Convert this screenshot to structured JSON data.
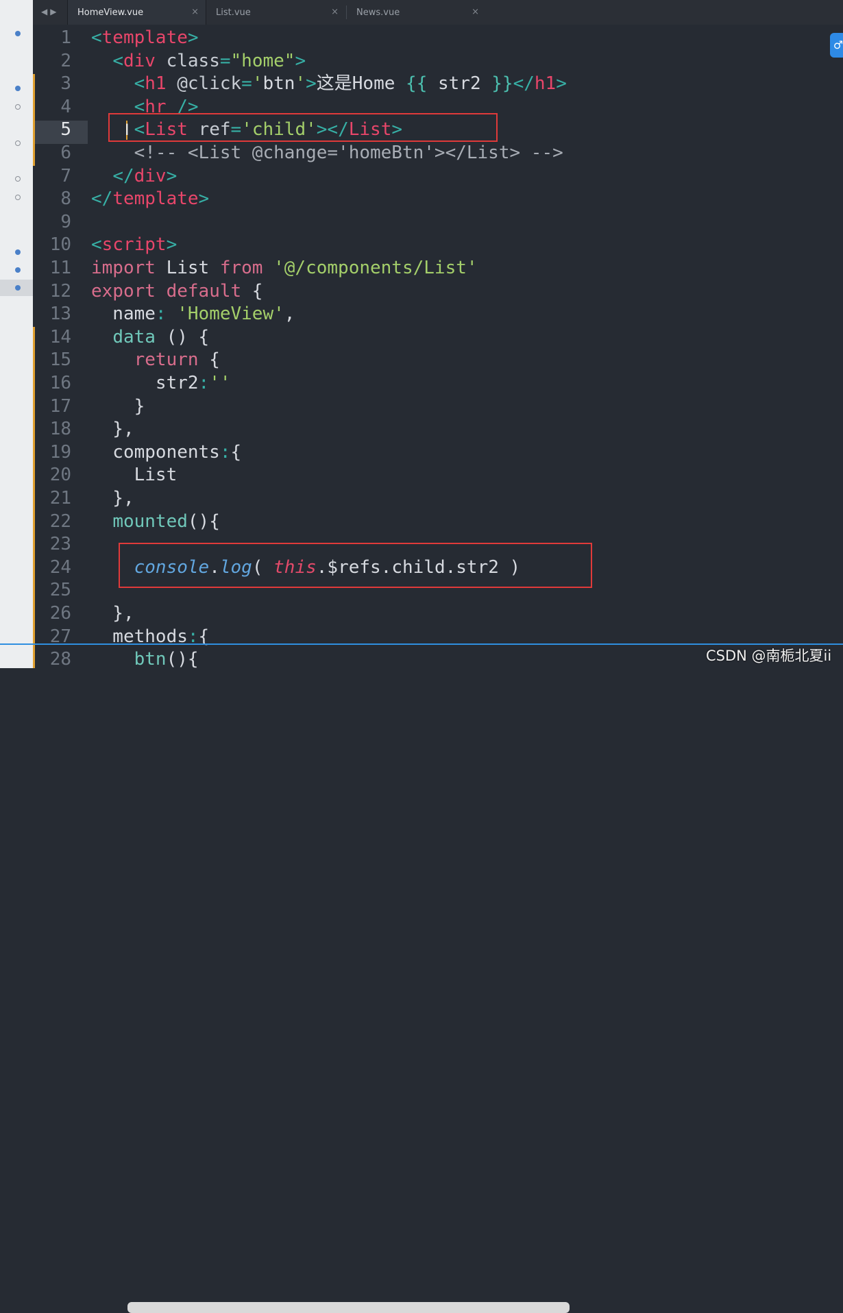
{
  "tabs": [
    {
      "label": "HomeView.vue",
      "active": true
    },
    {
      "label": "List.vue",
      "active": false
    },
    {
      "label": "News.vue",
      "active": false
    }
  ],
  "nav": {
    "back": "◀",
    "forward": "▶"
  },
  "close_glyph": "×",
  "current_line": 5,
  "watermark": "CSDN @南栀北夏ii",
  "right_widget_glyph": "♂",
  "icons": {
    "nav_back": "left-triangle-arrow",
    "nav_forward": "right-triangle-arrow",
    "close": "x-mark",
    "right_widget": "link-icon",
    "cursor": "i-beam-cursor"
  },
  "colors": {
    "tag": "#e8466a",
    "punctuation": "#37b0a6",
    "string": "#a4cf6a",
    "keyword": "#d86d8c",
    "comment": "#a8adb5",
    "highlight_box": "#e03a3a",
    "modified_marker": "#e0a030"
  },
  "lines": [
    {
      "n": "1",
      "tokens": [
        [
          "t-punc",
          "<"
        ],
        [
          "t-tag",
          "template"
        ],
        [
          "t-punc",
          ">"
        ]
      ]
    },
    {
      "n": "2",
      "tokens": [
        [
          "t-plain",
          "  "
        ],
        [
          "t-punc",
          "<"
        ],
        [
          "t-tag",
          "div"
        ],
        [
          "t-plain",
          " "
        ],
        [
          "t-attr",
          "class"
        ],
        [
          "t-punc",
          "="
        ],
        [
          "t-str",
          "\"home\""
        ],
        [
          "t-punc",
          ">"
        ]
      ]
    },
    {
      "n": "3",
      "tokens": [
        [
          "t-plain",
          "    "
        ],
        [
          "t-punc",
          "<"
        ],
        [
          "t-tag",
          "h1"
        ],
        [
          "t-plain",
          " "
        ],
        [
          "t-attr",
          "@click"
        ],
        [
          "t-punc",
          "="
        ],
        [
          "t-str",
          "'"
        ],
        [
          "t-plain",
          "btn"
        ],
        [
          "t-str",
          "'"
        ],
        [
          "t-punc",
          ">"
        ],
        [
          "t-plain",
          "这是Home "
        ],
        [
          "t-mustache",
          "{{"
        ],
        [
          "t-plain",
          " str2 "
        ],
        [
          "t-mustache",
          "}}"
        ],
        [
          "t-punc",
          "</"
        ],
        [
          "t-tag",
          "h1"
        ],
        [
          "t-punc",
          ">"
        ]
      ]
    },
    {
      "n": "4",
      "tokens": [
        [
          "t-plain",
          "    "
        ],
        [
          "t-punc",
          "<"
        ],
        [
          "t-tag",
          "hr"
        ],
        [
          "t-plain",
          " "
        ],
        [
          "t-punc",
          "/>"
        ]
      ]
    },
    {
      "n": "5",
      "tokens": [
        [
          "t-plain",
          "    "
        ],
        [
          "t-punc",
          "<"
        ],
        [
          "t-tag",
          "List"
        ],
        [
          "t-plain",
          " "
        ],
        [
          "t-attr",
          "ref"
        ],
        [
          "t-punc",
          "="
        ],
        [
          "t-str",
          "'child'"
        ],
        [
          "t-punc",
          "></"
        ],
        [
          "t-tag",
          "List"
        ],
        [
          "t-punc",
          ">"
        ]
      ]
    },
    {
      "n": "6",
      "tokens": [
        [
          "t-plain",
          "    "
        ],
        [
          "t-cmt",
          "<!-- <List @change='homeBtn'></List> -->"
        ]
      ]
    },
    {
      "n": "7",
      "tokens": [
        [
          "t-plain",
          "  "
        ],
        [
          "t-punc",
          "</"
        ],
        [
          "t-tag",
          "div"
        ],
        [
          "t-punc",
          ">"
        ]
      ]
    },
    {
      "n": "8",
      "tokens": [
        [
          "t-punc",
          "</"
        ],
        [
          "t-tag",
          "template"
        ],
        [
          "t-punc",
          ">"
        ]
      ]
    },
    {
      "n": "9",
      "tokens": []
    },
    {
      "n": "10",
      "tokens": [
        [
          "t-punc",
          "<"
        ],
        [
          "t-tag",
          "script"
        ],
        [
          "t-punc",
          ">"
        ]
      ]
    },
    {
      "n": "11",
      "tokens": [
        [
          "t-kw",
          "import"
        ],
        [
          "t-plain",
          " List "
        ],
        [
          "t-kw",
          "from"
        ],
        [
          "t-plain",
          " "
        ],
        [
          "t-str",
          "'@/components/List'"
        ]
      ]
    },
    {
      "n": "12",
      "tokens": [
        [
          "t-kw",
          "export"
        ],
        [
          "t-plain",
          " "
        ],
        [
          "t-kw",
          "default"
        ],
        [
          "t-plain",
          " {"
        ]
      ]
    },
    {
      "n": "13",
      "tokens": [
        [
          "t-plain",
          "  name"
        ],
        [
          "t-punc",
          ":"
        ],
        [
          "t-plain",
          " "
        ],
        [
          "t-str",
          "'HomeView'"
        ],
        [
          "t-plain",
          ","
        ]
      ]
    },
    {
      "n": "14",
      "tokens": [
        [
          "t-plain",
          "  "
        ],
        [
          "t-fn",
          "data"
        ],
        [
          "t-plain",
          " () {"
        ]
      ]
    },
    {
      "n": "15",
      "tokens": [
        [
          "t-plain",
          "    "
        ],
        [
          "t-kw",
          "return"
        ],
        [
          "t-plain",
          " {"
        ]
      ]
    },
    {
      "n": "16",
      "tokens": [
        [
          "t-plain",
          "      str2"
        ],
        [
          "t-punc",
          ":"
        ],
        [
          "t-str",
          "''"
        ]
      ]
    },
    {
      "n": "17",
      "tokens": [
        [
          "t-plain",
          "    }"
        ]
      ]
    },
    {
      "n": "18",
      "tokens": [
        [
          "t-plain",
          "  },"
        ]
      ]
    },
    {
      "n": "19",
      "tokens": [
        [
          "t-plain",
          "  components"
        ],
        [
          "t-punc",
          ":"
        ],
        [
          "t-plain",
          "{"
        ]
      ]
    },
    {
      "n": "20",
      "tokens": [
        [
          "t-plain",
          "    List"
        ]
      ]
    },
    {
      "n": "21",
      "tokens": [
        [
          "t-plain",
          "  },"
        ]
      ]
    },
    {
      "n": "22",
      "tokens": [
        [
          "t-plain",
          "  "
        ],
        [
          "t-fn",
          "mounted"
        ],
        [
          "t-plain",
          "(){"
        ]
      ]
    },
    {
      "n": "23",
      "tokens": []
    },
    {
      "n": "24",
      "tokens": [
        [
          "t-plain",
          "    "
        ],
        [
          "t-obj",
          "console"
        ],
        [
          "t-plain",
          "."
        ],
        [
          "t-obj",
          "log"
        ],
        [
          "t-plain",
          "( "
        ],
        [
          "t-this",
          "this"
        ],
        [
          "t-plain",
          ".$refs.child.str2 )"
        ]
      ]
    },
    {
      "n": "25",
      "tokens": []
    },
    {
      "n": "26",
      "tokens": [
        [
          "t-plain",
          "  },"
        ]
      ]
    },
    {
      "n": "27",
      "tokens": [
        [
          "t-plain",
          "  methods"
        ],
        [
          "t-punc",
          ":"
        ],
        [
          "t-plain",
          "{"
        ]
      ]
    },
    {
      "n": "28",
      "tokens": [
        [
          "t-plain",
          "    "
        ],
        [
          "t-fn",
          "btn"
        ],
        [
          "t-plain",
          "(){"
        ]
      ]
    }
  ]
}
